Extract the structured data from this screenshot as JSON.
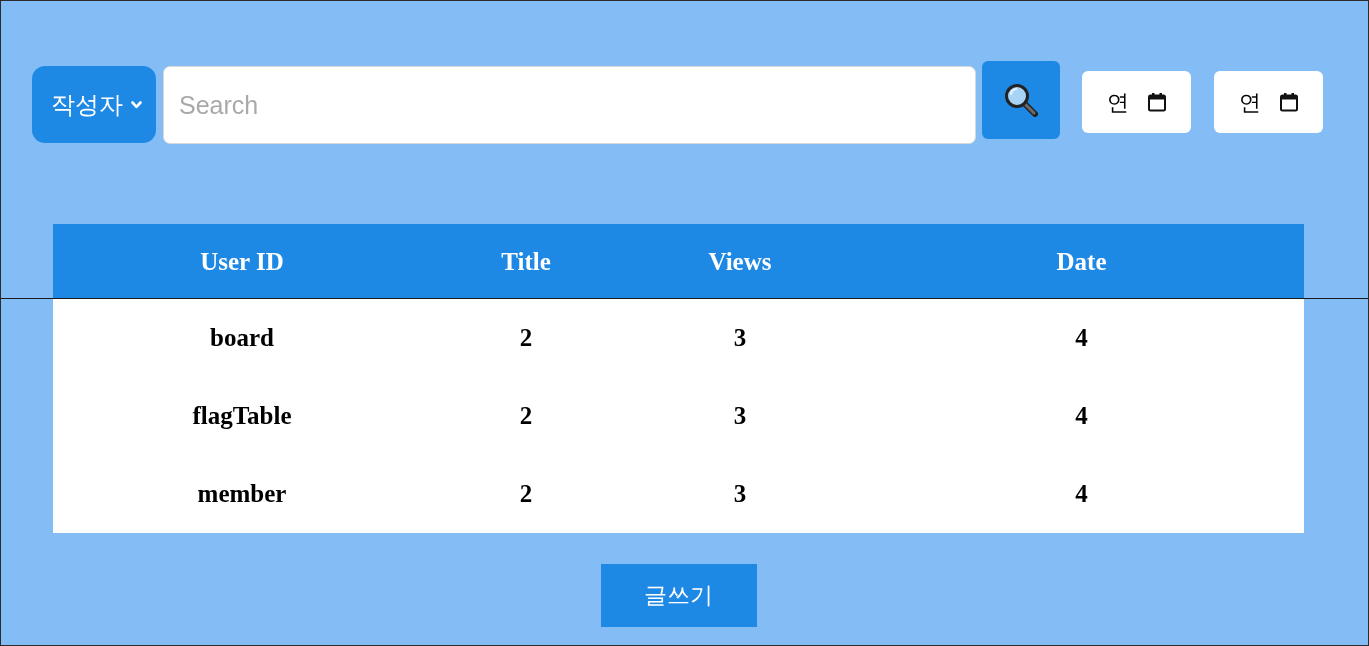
{
  "search_bar": {
    "filter": {
      "label": "작성자"
    },
    "search": {
      "placeholder": "Search"
    },
    "date_fields": [
      {
        "value": "연"
      },
      {
        "value": "연"
      }
    ]
  },
  "table": {
    "columns": [
      "User ID",
      "Title",
      "Views",
      "Date"
    ],
    "rows": [
      [
        "board",
        "2",
        "3",
        "4"
      ],
      [
        "flagTable",
        "2",
        "3",
        "4"
      ],
      [
        "member",
        "2",
        "3",
        "4"
      ]
    ]
  },
  "write_button": {
    "label": "글쓰기"
  }
}
